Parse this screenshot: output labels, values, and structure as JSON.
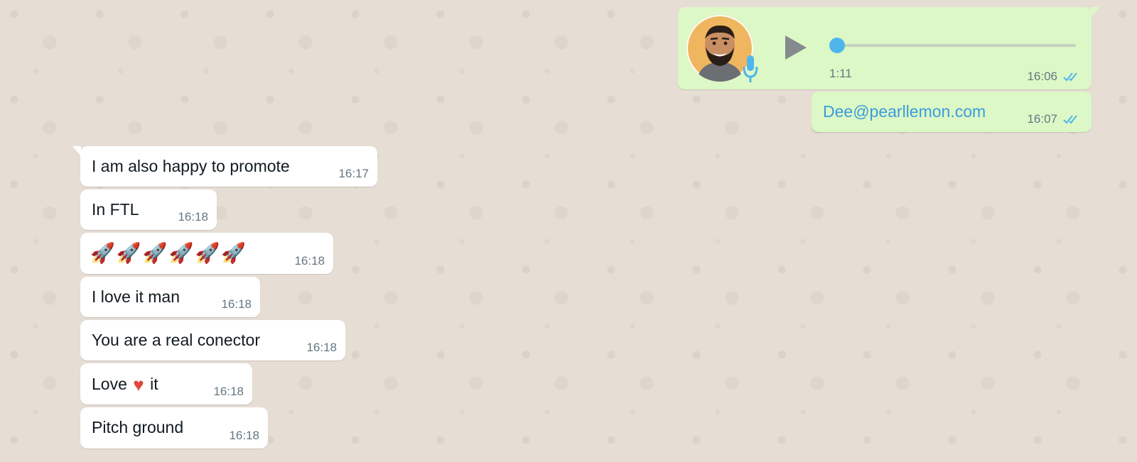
{
  "voice_message": {
    "duration": "1:11",
    "time": "16:06",
    "progress": 0.0,
    "status": "read"
  },
  "outgoing_link": {
    "text": "Dee@pearllemon.com",
    "time": "16:07",
    "status": "read"
  },
  "incoming": [
    {
      "text": "I am also happy to promote",
      "time": "16:17"
    },
    {
      "text": "In FTL",
      "time": "16:18"
    },
    {
      "emoji": "🚀🚀🚀🚀🚀🚀",
      "time": "16:18"
    },
    {
      "text": "I love it man",
      "time": "16:18"
    },
    {
      "text": "You are a real conector",
      "time": "16:18"
    },
    {
      "text_before": "Love",
      "text_after": "it",
      "heart": "♥",
      "time": "16:18"
    },
    {
      "text": "Pitch ground",
      "time": "16:18"
    }
  ],
  "colors": {
    "background": "#e6ded5",
    "outgoing_bubble": "#dcf8c6",
    "incoming_bubble": "#ffffff",
    "read_ticks": "#4fb6ec",
    "link": "#3a9cdc"
  },
  "icons": {
    "play": "play-icon",
    "mic": "microphone-icon",
    "ticks": "double-check-icon"
  }
}
